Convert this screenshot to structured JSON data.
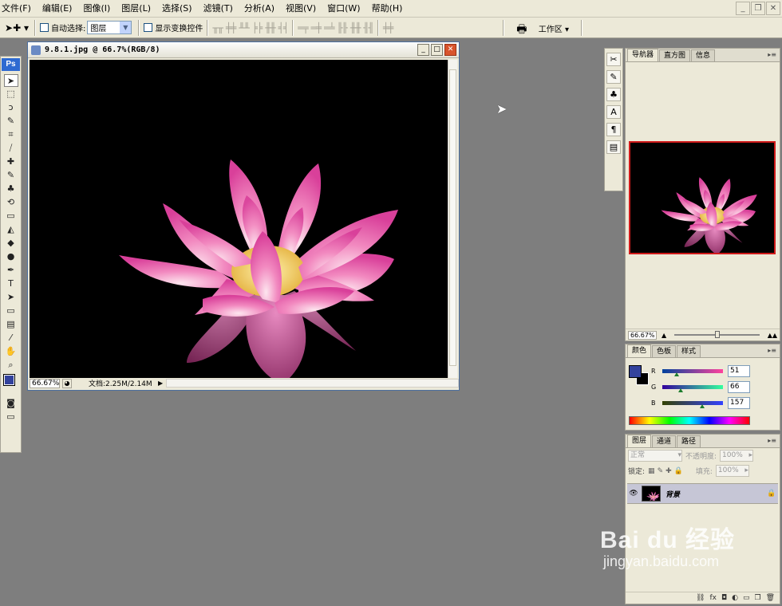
{
  "menu": {
    "items": [
      "文件(F)",
      "编辑(E)",
      "图像(I)",
      "图层(L)",
      "选择(S)",
      "滤镜(T)",
      "分析(A)",
      "视图(V)",
      "窗口(W)",
      "帮助(H)"
    ]
  },
  "options_bar": {
    "auto_select_label": "自动选择:",
    "auto_select_value": "图层",
    "show_transform_label": "显示变换控件",
    "workspace_label": "工作区 ▾"
  },
  "toolbox": {
    "logo": "Ps",
    "tools": [
      "move-icon",
      "marquee-icon",
      "lasso-icon",
      "magic-wand-icon",
      "crop-icon",
      "slice-icon",
      "healing-icon",
      "brush-icon",
      "clone-stamp-icon",
      "history-brush-icon",
      "eraser-icon",
      "paint-bucket-icon",
      "blur-icon",
      "dodge-icon",
      "pen-icon",
      "type-icon",
      "path-select-icon",
      "shape-icon",
      "notes-icon",
      "eyedropper-icon",
      "hand-icon",
      "zoom-icon"
    ],
    "tool_glyphs": [
      "➤",
      "⬚",
      "ↄ",
      "✎",
      "⌗",
      "⧸",
      "✚",
      "✎",
      "♣",
      "⟲",
      "▭",
      "◭",
      "◆",
      "●",
      "✒",
      "T",
      "➤",
      "▭",
      "▤",
      "⁄",
      "✋",
      "⌕"
    ],
    "foreground_color": "#33429d",
    "background_color": "#000000"
  },
  "document": {
    "title": "9.8.1.jpg @ 66.7%(RGB/8)",
    "zoom": "66.67%",
    "doc_size": "文档:2.25M/2.14M"
  },
  "navigator": {
    "tabs": [
      "导航器",
      "直方图",
      "信息"
    ],
    "zoom": "66.67%"
  },
  "color_panel": {
    "tabs": [
      "颜色",
      "色板",
      "样式"
    ],
    "channels": [
      {
        "label": "R",
        "value": "51",
        "fraction": 0.2
      },
      {
        "label": "G",
        "value": "66",
        "fraction": 0.26
      },
      {
        "label": "B",
        "value": "157",
        "fraction": 0.62
      }
    ]
  },
  "layers_panel": {
    "tabs": [
      "图层",
      "通道",
      "路径"
    ],
    "blend_mode": "正常",
    "opacity_label": "不透明度:",
    "opacity_value": "100%",
    "lock_label": "锁定:",
    "fill_label": "填充:",
    "fill_value": "100%",
    "layer_name": "背景"
  },
  "watermark": {
    "brand": "Bai du 经验",
    "url": "jingyan.baidu.com"
  },
  "colors": {
    "accent_blue": "#33429d",
    "navigator_frame": "#d01a1a",
    "chrome": "#ece9d8",
    "workspace": "#7e7e7e"
  }
}
